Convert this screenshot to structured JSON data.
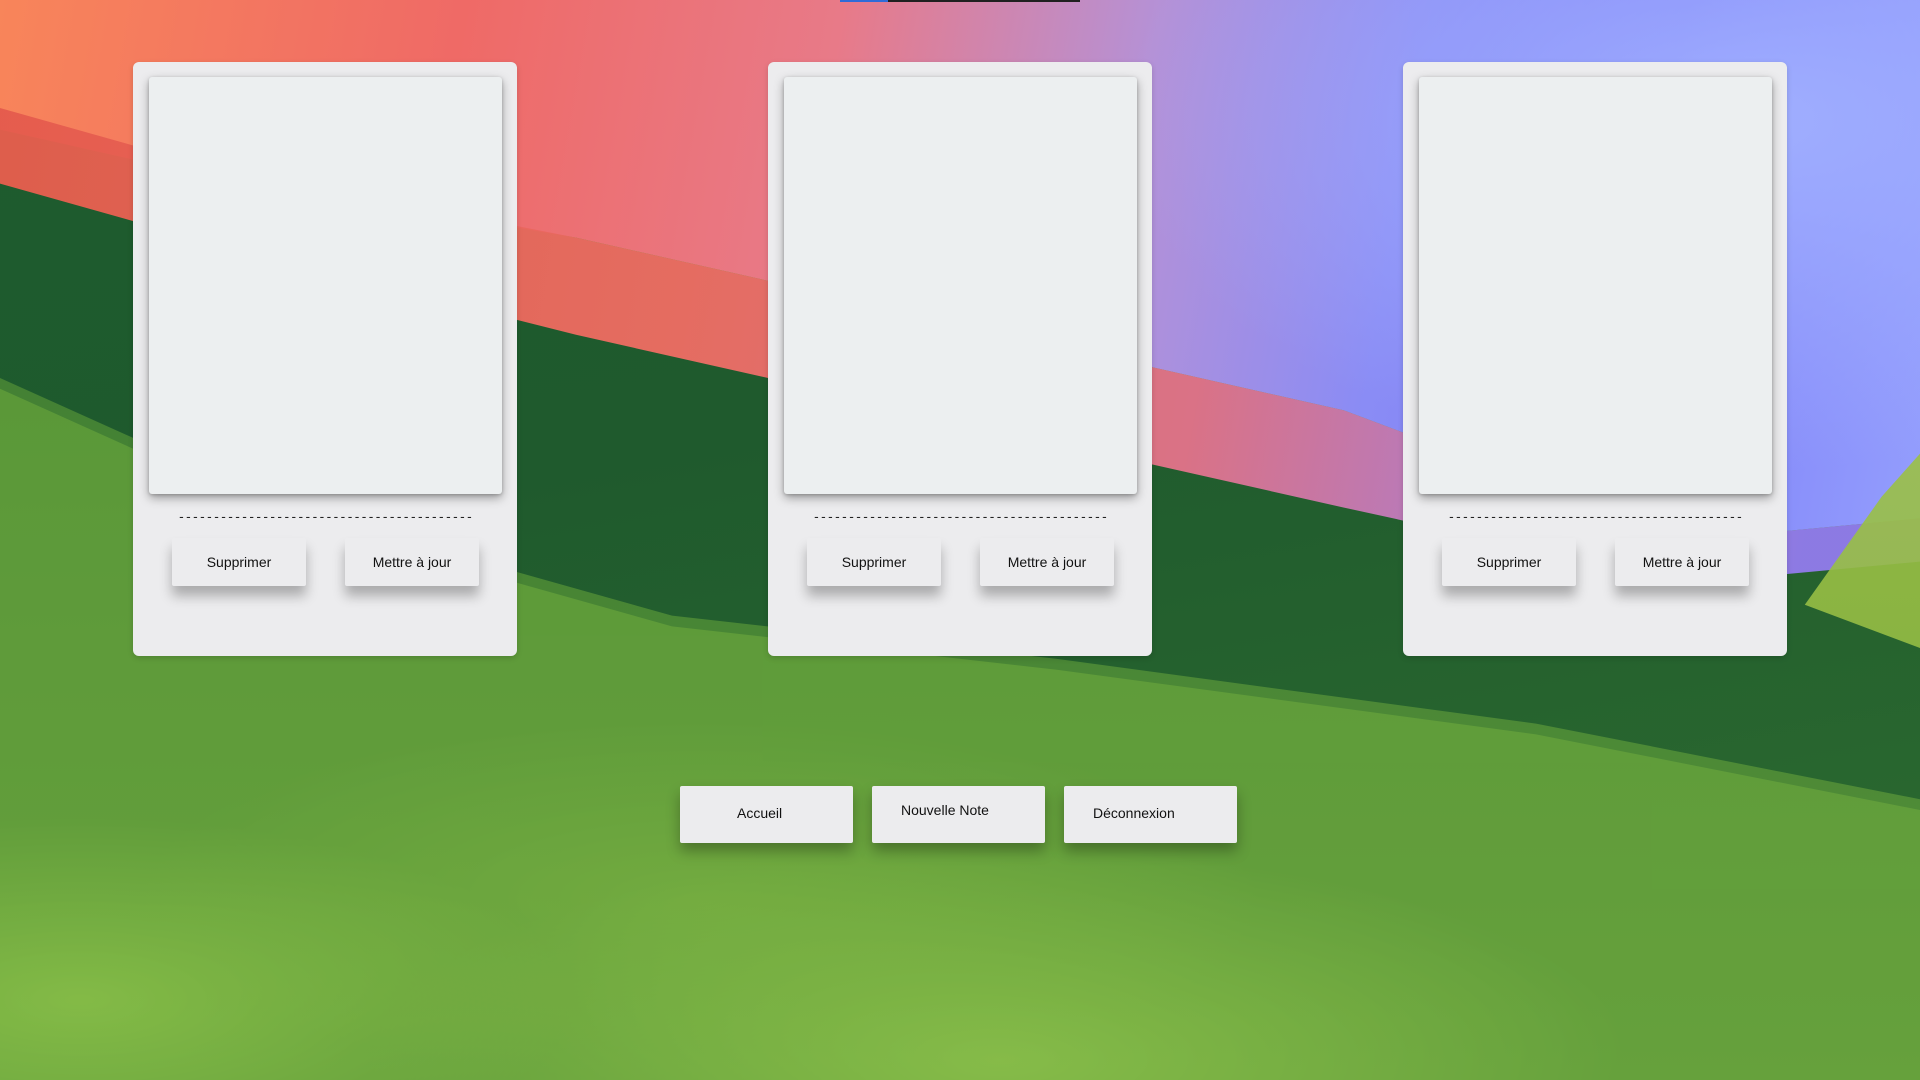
{
  "notes": [
    {
      "content": "",
      "separator": "------------------------------------------",
      "delete_label": "Supprimer",
      "update_label": "Mettre à jour"
    },
    {
      "content": "",
      "separator": "------------------------------------------",
      "delete_label": "Supprimer",
      "update_label": "Mettre à jour"
    },
    {
      "content": "",
      "separator": "------------------------------------------",
      "delete_label": "Supprimer",
      "update_label": "Mettre à jour"
    }
  ],
  "nav": {
    "home_label": "Accueil",
    "new_note_label": "Nouvelle Note",
    "logout_label": "Déconnexion"
  },
  "colors": {
    "card_bg": "#ececee",
    "note_bg": "#eceff0",
    "text": "#111111"
  }
}
